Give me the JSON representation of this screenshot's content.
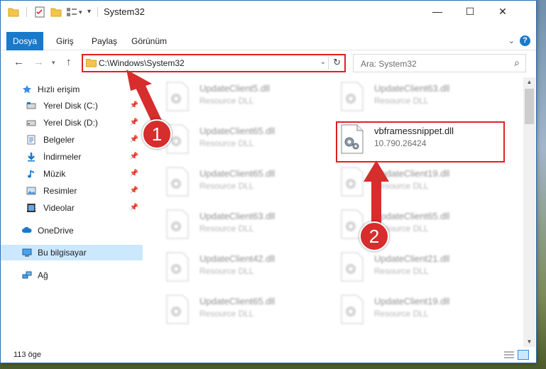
{
  "window": {
    "title": "System32",
    "controls": {
      "minimize": "—",
      "maximize": "☐",
      "close": "✕"
    }
  },
  "ribbon": {
    "file_tab": "Dosya",
    "tabs": [
      "Giriş",
      "Paylaş",
      "Görünüm"
    ],
    "help": "?"
  },
  "address": {
    "path": "C:\\Windows\\System32",
    "search_placeholder": "Ara: System32"
  },
  "navpane": {
    "quick_access": "Hızlı erişim",
    "items": [
      {
        "label": "Yerel Disk (C:)",
        "icon": "drive-icon"
      },
      {
        "label": "Yerel Disk (D:)",
        "icon": "drive-icon"
      },
      {
        "label": "Belgeler",
        "icon": "documents-icon"
      },
      {
        "label": "İndirmeler",
        "icon": "downloads-icon"
      },
      {
        "label": "Müzik",
        "icon": "music-icon"
      },
      {
        "label": "Resimler",
        "icon": "pictures-icon"
      },
      {
        "label": "Videolar",
        "icon": "videos-icon"
      }
    ],
    "onedrive": "OneDrive",
    "this_pc": "Bu bilgisayar",
    "network": "Ağ"
  },
  "files": {
    "left_column": [
      {
        "name": "UpdateClient5.dll",
        "desc": "Resource DLL"
      },
      {
        "name": "UpdateClient65.dll",
        "desc": "Resource DLL"
      },
      {
        "name": "UpdateClient65.dll",
        "desc": "Resource DLL"
      },
      {
        "name": "UpdateClient63.dll",
        "desc": "Resource DLL"
      },
      {
        "name": "UpdateClient42.dll",
        "desc": "Resource DLL"
      },
      {
        "name": "UpdateClient65.dll",
        "desc": "Resource DLL"
      }
    ],
    "right_column": [
      {
        "name": "UpdateClient63.dll",
        "desc": "Resource DLL"
      },
      {
        "name": "vbframessnippet.dll",
        "desc": "10.790.26424"
      },
      {
        "name": "UpdateClient19.dll",
        "desc": "Resource DLL"
      },
      {
        "name": "UpdateClient65.dll",
        "desc": "Resource DLL"
      },
      {
        "name": "UpdateClient21.dll",
        "desc": "Resource DLL"
      },
      {
        "name": "UpdateClient19.dll",
        "desc": "Resource DLL"
      }
    ]
  },
  "status": {
    "count": "113 öge"
  },
  "annotations": {
    "step1": "1",
    "step2": "2"
  },
  "colors": {
    "accent": "#1979ca",
    "annotation": "#e02020",
    "selected": "#cce8ff"
  }
}
